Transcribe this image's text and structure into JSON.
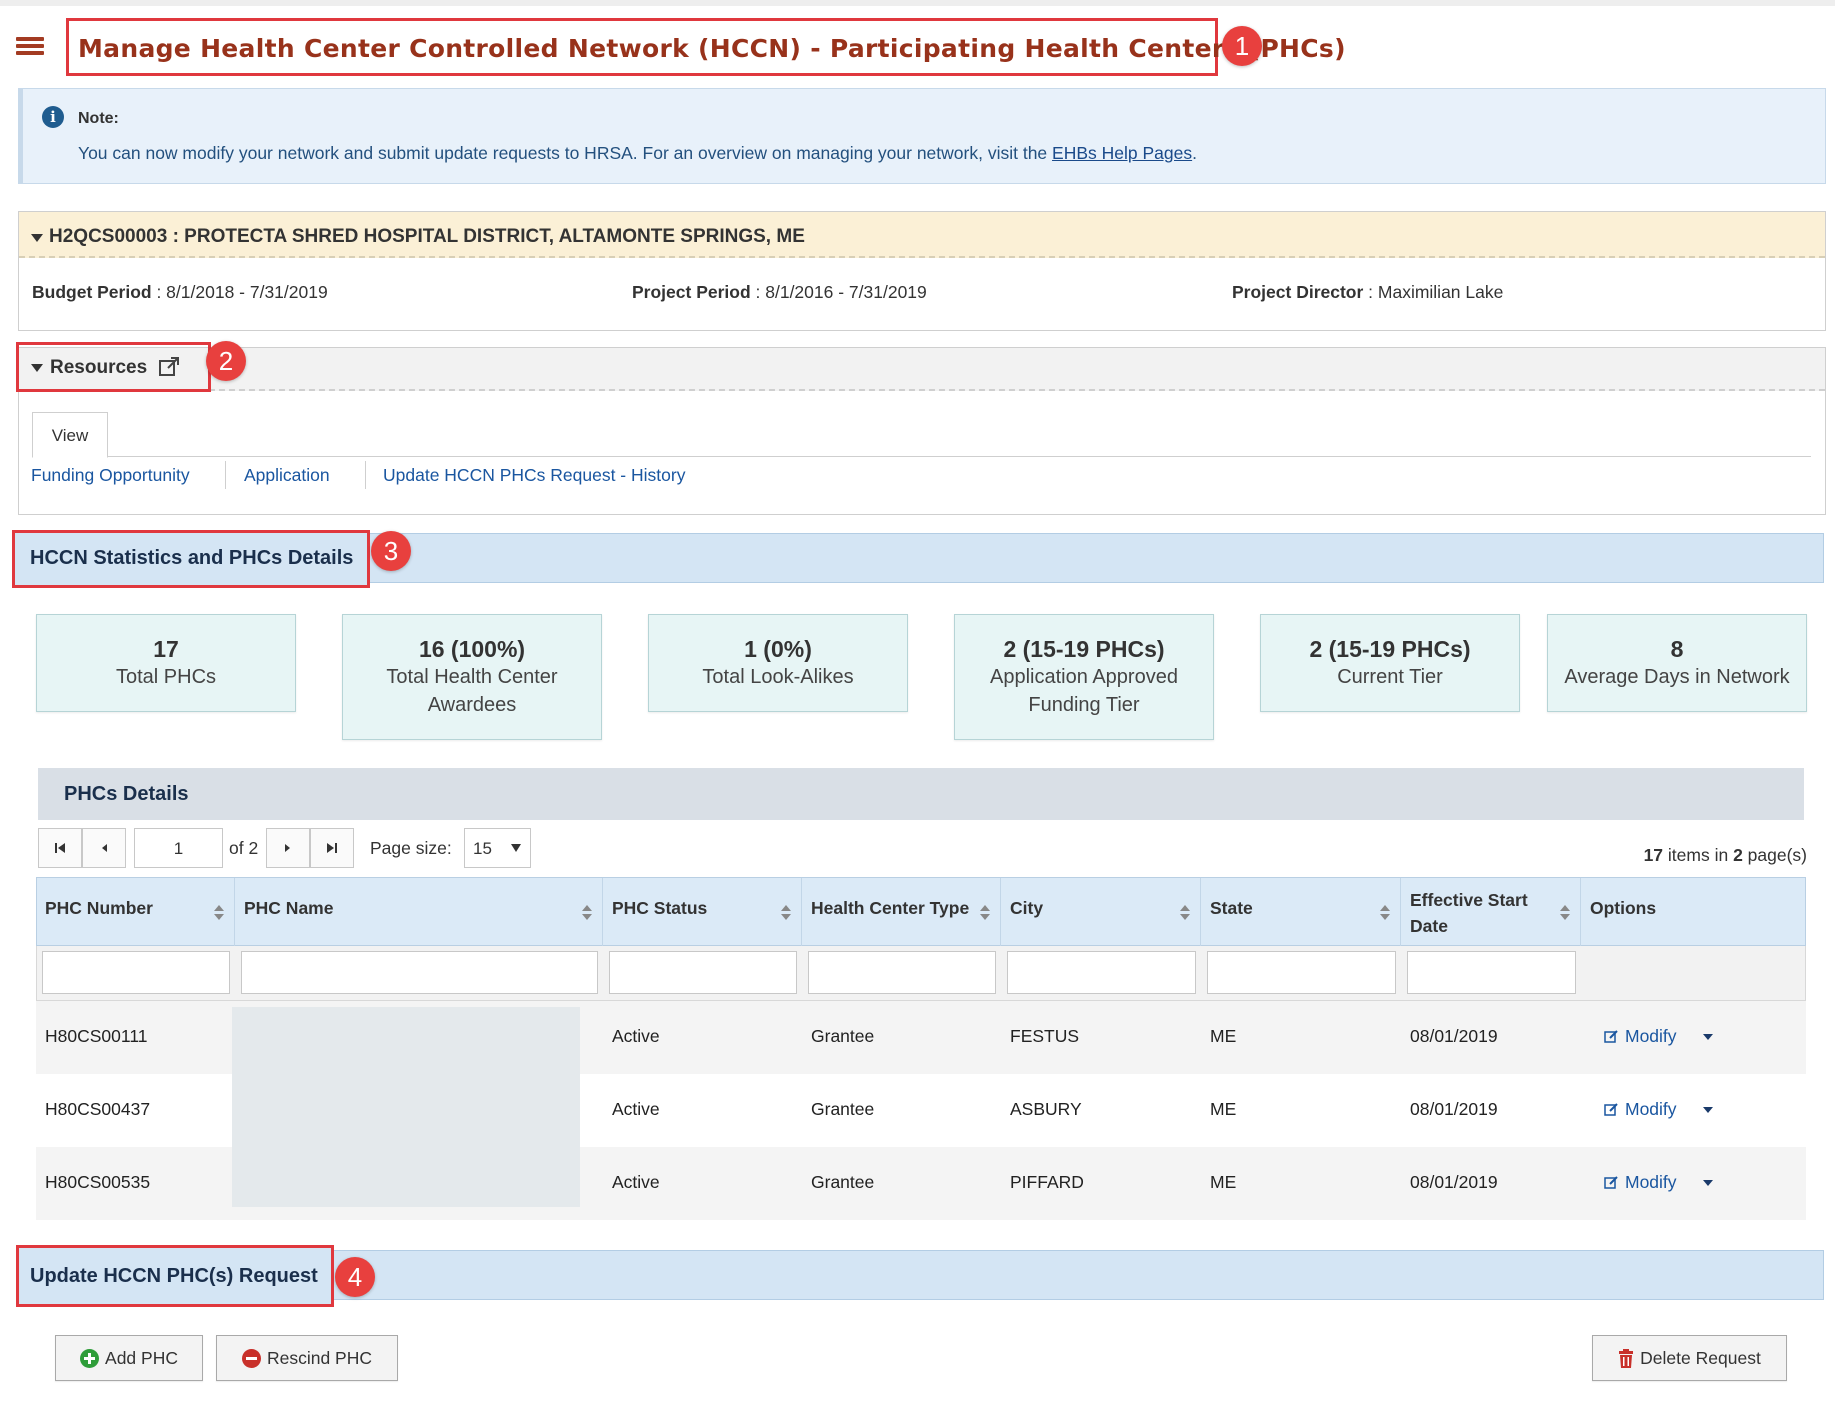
{
  "page": {
    "title": "Manage Health Center Controlled Network (HCCN) - Participating Health Centers (PHCs)"
  },
  "callouts": [
    "1",
    "2",
    "3",
    "4"
  ],
  "note": {
    "label": "Note:",
    "text": "You can now modify your network and submit update requests to HRSA. For an overview on managing your network, visit the ",
    "link": "EHBs Help Pages",
    "suffix": "."
  },
  "grant": {
    "header": "H2QCS00003 : PROTECTA SHRED HOSPITAL DISTRICT, ALTAMONTE SPRINGS, ME",
    "budget_label": "Budget Period",
    "budget_value": " : 8/1/2018 - 7/31/2019",
    "project_label": "Project Period",
    "project_value": " : 8/1/2016 - 7/31/2019",
    "director_label": "Project Director",
    "director_value": " : Maximilian Lake"
  },
  "resources": {
    "title": "Resources",
    "tab": "View",
    "links": [
      "Funding Opportunity",
      "Application",
      "Update HCCN PHCs Request - History"
    ]
  },
  "stats": {
    "section_title": "HCCN Statistics and PHCs Details",
    "cards": [
      {
        "num": "17",
        "label": "Total PHCs"
      },
      {
        "num": "16 (100%)",
        "label": "Total Health Center Awardees"
      },
      {
        "num": "1 (0%)",
        "label": "Total Look-Alikes"
      },
      {
        "num": "2 (15-19 PHCs)",
        "label": "Application Approved Funding Tier"
      },
      {
        "num": "2 (15-19 PHCs)",
        "label": "Current Tier"
      },
      {
        "num": "8",
        "label": "Average Days in Network"
      }
    ]
  },
  "details": {
    "title": "PHCs Details",
    "pager": {
      "page": "1",
      "of_label": "of 2",
      "page_size_label": "Page size:",
      "page_size": "15",
      "items_count": "17",
      "items_mid": " items in ",
      "pages_count": "2",
      "items_suffix": " page(s)"
    },
    "columns": [
      "PHC Number",
      "PHC Name",
      "PHC Status",
      "Health Center Type",
      "City",
      "State",
      "Effective Start Date",
      "Options"
    ],
    "rows": [
      {
        "number": "H80CS00111",
        "status": "Active",
        "type": "Grantee",
        "city": "FESTUS",
        "state": "ME",
        "date": "08/01/2019",
        "option": "Modify"
      },
      {
        "number": "H80CS00437",
        "status": "Active",
        "type": "Grantee",
        "city": "ASBURY",
        "state": "ME",
        "date": "08/01/2019",
        "option": "Modify"
      },
      {
        "number": "H80CS00535",
        "status": "Active",
        "type": "Grantee",
        "city": "PIFFARD",
        "state": "ME",
        "date": "08/01/2019",
        "option": "Modify"
      }
    ]
  },
  "request": {
    "section_title": "Update HCCN PHC(s) Request",
    "add_label": "Add PHC",
    "rescind_label": "Rescind PHC",
    "delete_label": "Delete Request"
  },
  "colors": {
    "title": "#98321b",
    "callout": "#e8403e",
    "link": "#1a56a0",
    "section_bar": "#d4e5f4"
  }
}
